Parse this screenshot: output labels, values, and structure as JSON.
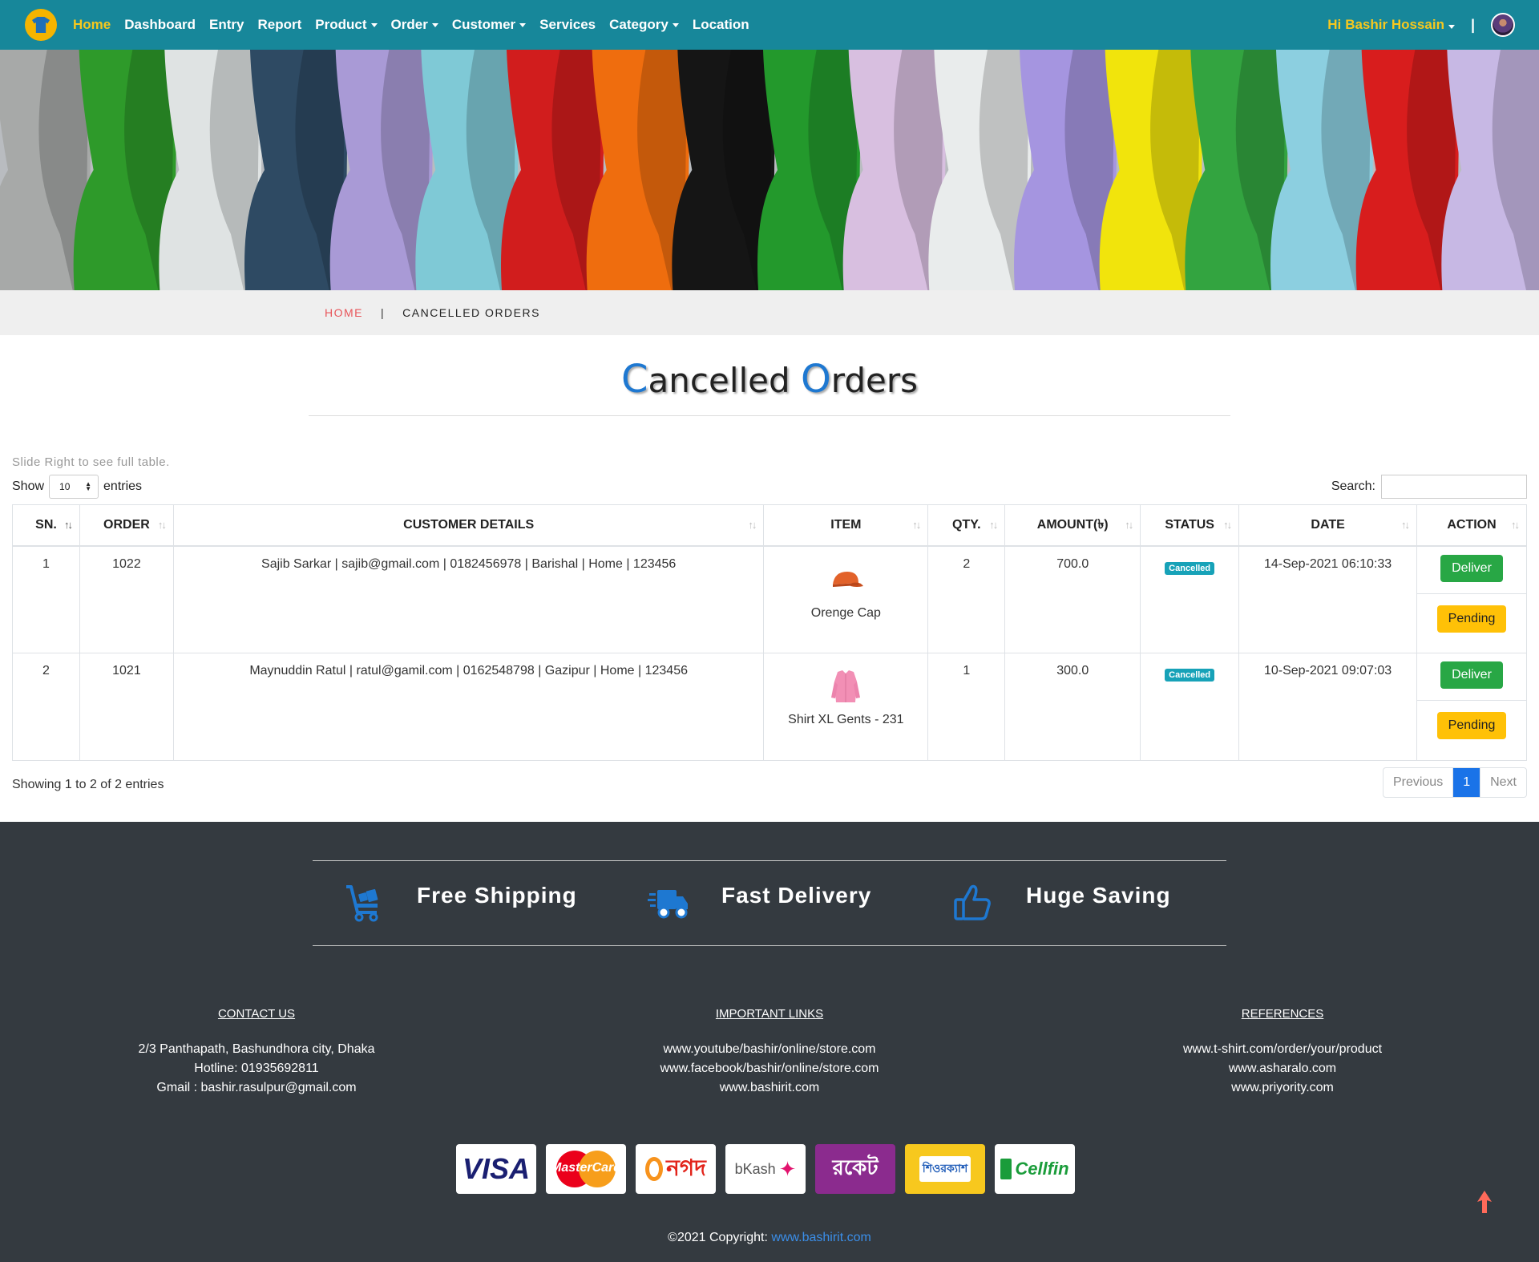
{
  "nav": {
    "items": [
      {
        "label": "Home",
        "active": true,
        "dropdown": false
      },
      {
        "label": "Dashboard",
        "active": false,
        "dropdown": false
      },
      {
        "label": "Entry",
        "active": false,
        "dropdown": false
      },
      {
        "label": "Report",
        "active": false,
        "dropdown": false
      },
      {
        "label": "Product",
        "active": false,
        "dropdown": true
      },
      {
        "label": "Order",
        "active": false,
        "dropdown": true
      },
      {
        "label": "Customer",
        "active": false,
        "dropdown": true
      },
      {
        "label": "Services",
        "active": false,
        "dropdown": false
      },
      {
        "label": "Category",
        "active": false,
        "dropdown": true
      },
      {
        "label": "Location",
        "active": false,
        "dropdown": false
      }
    ],
    "greeting": "Hi",
    "user_name": "Bashir Hossain",
    "separator": "|"
  },
  "breadcrumb": {
    "home": "HOME",
    "sep": "|",
    "current": "CANCELLED ORDERS"
  },
  "page": {
    "title_c1": "C",
    "title_rest1": "ancelled ",
    "title_c2": "O",
    "title_rest2": "rders"
  },
  "table_controls": {
    "slide_hint": "Slide Right to see full table.",
    "show_label": "Show",
    "page_size": "10",
    "entries_label": "entries",
    "search_label": "Search:",
    "search_value": ""
  },
  "table": {
    "headers": [
      "SN.",
      "ORDER",
      "CUSTOMER DETAILS",
      "ITEM",
      "QTY.",
      "AMOUNT(৳)",
      "STATUS",
      "DATE",
      "ACTION"
    ],
    "rows": [
      {
        "sn": "1",
        "order": "1022",
        "customer": "Sajib Sarkar | sajib@gmail.com | 0182456978 | Barishal | Home | 123456",
        "item": "Orenge Cap",
        "item_icon": "cap-image",
        "qty": "2",
        "amount": "700.0",
        "status": "Cancelled",
        "date": "14-Sep-2021 06:10:33",
        "deliver": "Deliver",
        "pending": "Pending"
      },
      {
        "sn": "2",
        "order": "1021",
        "customer": "Maynuddin Ratul | ratul@gamil.com | 0162548798 | Gazipur | Home | 123456",
        "item": "Shirt XL Gents - 231",
        "item_icon": "shirt-image",
        "qty": "1",
        "amount": "300.0",
        "status": "Cancelled",
        "date": "10-Sep-2021 09:07:03",
        "deliver": "Deliver",
        "pending": "Pending"
      }
    ],
    "showing": "Showing 1 to 2 of 2 entries",
    "pager": {
      "prev": "Previous",
      "page": "1",
      "next": "Next"
    }
  },
  "footer": {
    "features": [
      {
        "label": "Free Shipping",
        "icon": "cart-icon"
      },
      {
        "label": "Fast Delivery",
        "icon": "truck-icon"
      },
      {
        "label": "Huge Saving",
        "icon": "thumbs-up-icon"
      }
    ],
    "contact": {
      "heading": "CONTACT US",
      "lines": [
        "2/3 Panthapath, Bashundhora city, Dhaka",
        "Hotline: 01935692811",
        "Gmail : bashir.rasulpur@gmail.com"
      ]
    },
    "links": {
      "heading": "IMPORTANT LINKS",
      "lines": [
        "www.youtube/bashir/online/store.com",
        "www.facebook/bashir/online/store.com",
        "www.bashirit.com"
      ]
    },
    "references": {
      "heading": "REFERENCES",
      "lines": [
        "www.t-shirt.com/order/your/product",
        "www.asharalo.com",
        "www.priyority.com"
      ]
    },
    "payments": [
      "VISA",
      "MasterCard",
      "নগদ",
      "bKash",
      "রকেট",
      "শিওরক্যাশ",
      "Cellfin"
    ],
    "copyright_prefix": "©2021 Copyright: ",
    "copyright_link": "www.bashirit.com"
  },
  "colors": {
    "navbar": "#17879a",
    "accent": "#f7c81e",
    "footer": "#343a40",
    "title_accent": "#1e78d1"
  }
}
